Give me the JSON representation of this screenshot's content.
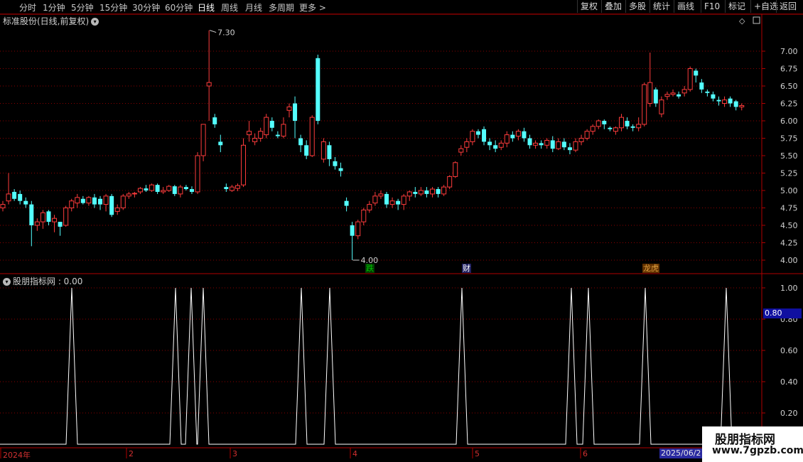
{
  "toolbar": {
    "periods": [
      "分时",
      "1分钟",
      "5分钟",
      "15分钟",
      "30分钟",
      "60分钟",
      "日线",
      "周线",
      "月线",
      "多周期",
      "更多 >"
    ],
    "active_period": "日线",
    "right_buttons": [
      "复权",
      "叠加",
      "多股",
      "统计",
      "画线",
      "F10",
      "标记",
      "+自选",
      "返回"
    ]
  },
  "main_chart": {
    "title": "标准股份(日线,前复权)",
    "y_ticks": [
      "7.00",
      "6.75",
      "6.50",
      "6.25",
      "6.00",
      "5.75",
      "5.50",
      "5.25",
      "5.00",
      "4.75",
      "4.50",
      "4.25",
      "4.00"
    ],
    "high_label": "7.30",
    "low_label": "4.00",
    "tags": [
      {
        "text": "跌",
        "color": "#00c000"
      },
      {
        "text": "财",
        "color": "#ffffff"
      },
      {
        "text": "龙虎",
        "color": "#e0a040"
      }
    ]
  },
  "indicator": {
    "title": "股朋指标网 : 0.00",
    "y_ticks": [
      "1.00",
      "0.80",
      "0.60",
      "0.40",
      "0.20"
    ],
    "current_value": "0.80"
  },
  "x_axis": {
    "labels": [
      "2024年",
      "2",
      "3",
      "4",
      "5",
      "6"
    ],
    "current_date": "2025/06/2"
  },
  "watermark": {
    "line1": "股朋指标网",
    "line2": "www.7gpzb.com"
  },
  "colors": {
    "up": "#ff3c3c",
    "down": "#54ffff",
    "grid": "#8b0000",
    "indicator_line": "#ffffff"
  }
}
